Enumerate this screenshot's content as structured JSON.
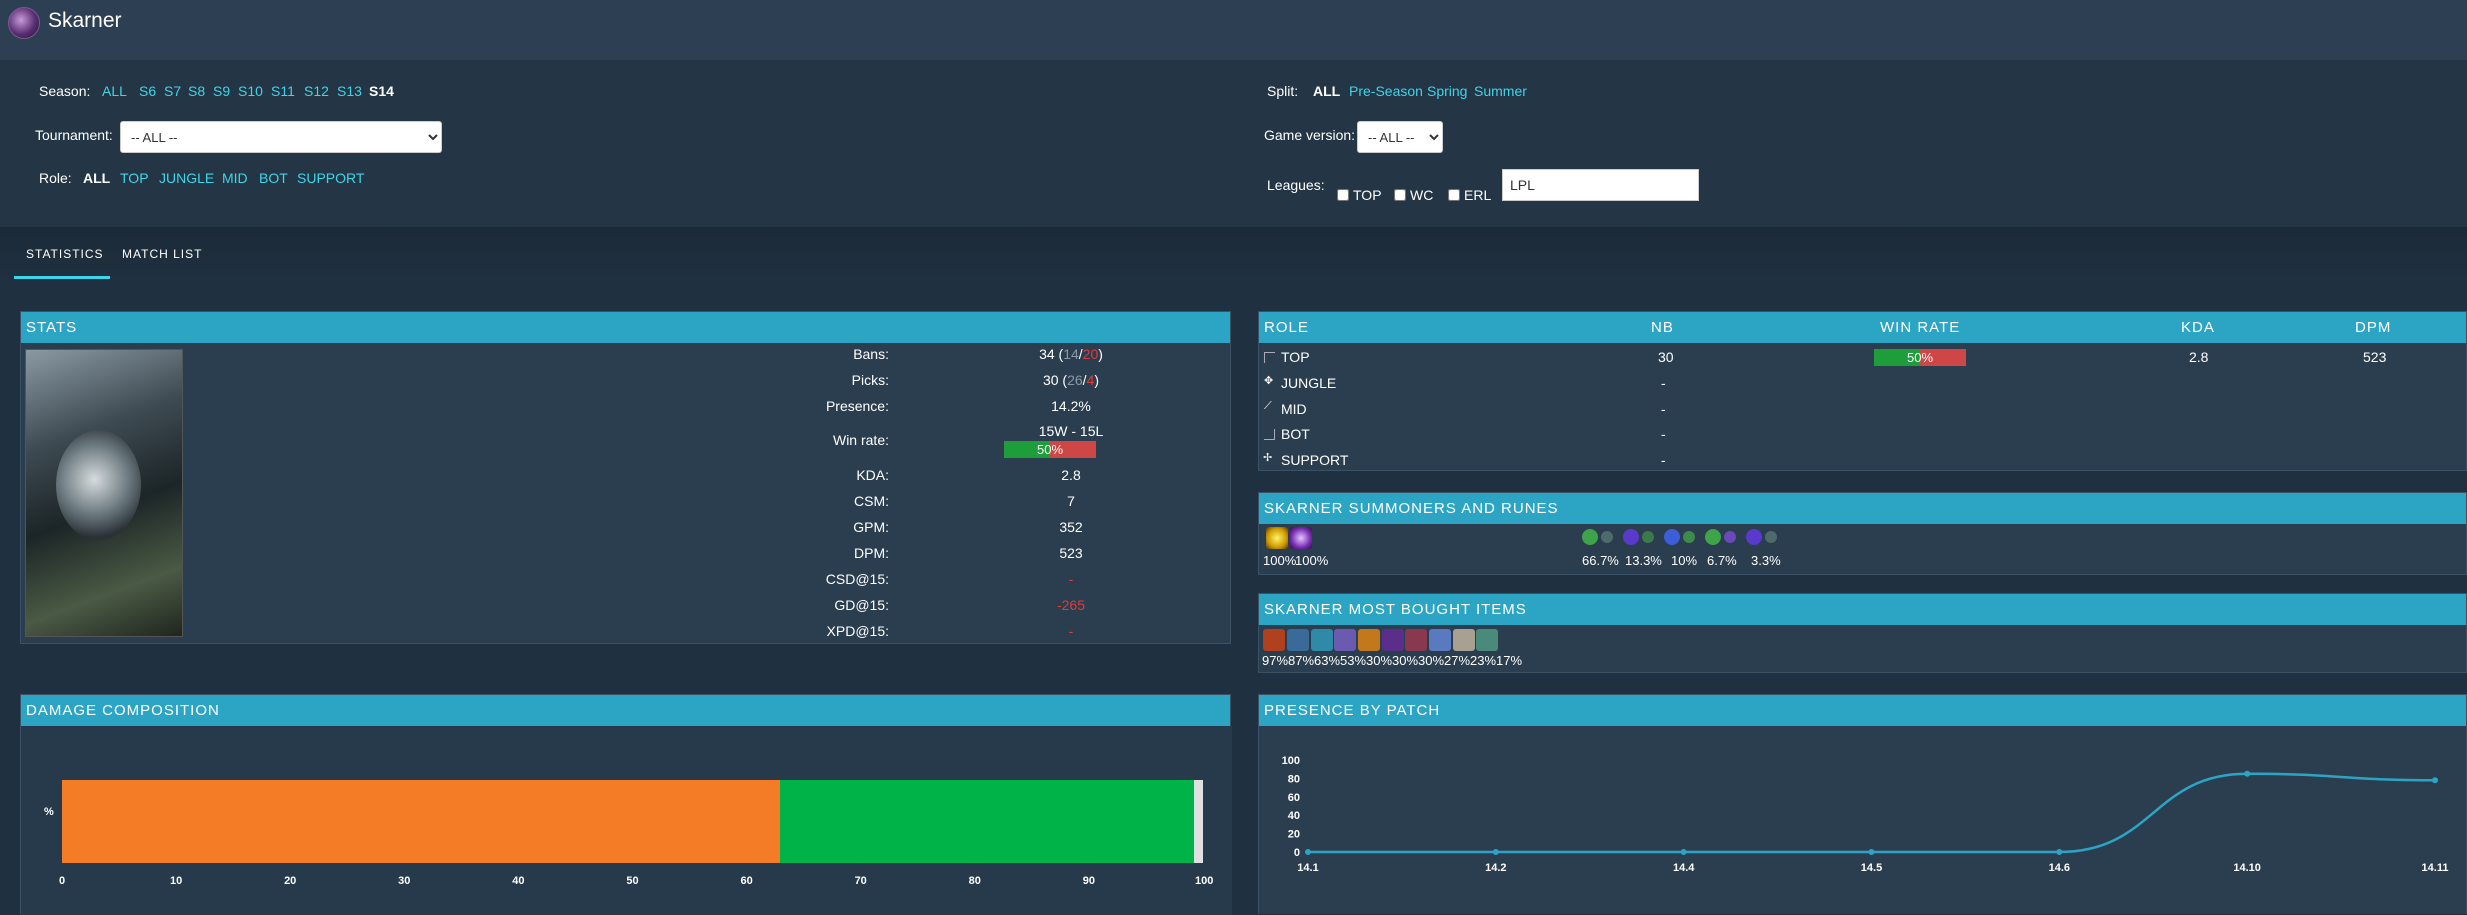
{
  "header": {
    "champion": "Skarner"
  },
  "filters": {
    "season_label": "Season:",
    "seasons": [
      "ALL",
      "S6",
      "S7",
      "S8",
      "S9",
      "S10",
      "S11",
      "S12",
      "S13",
      "S14"
    ],
    "season_active": "S14",
    "tournament_label": "Tournament:",
    "tournament_value": "-- ALL --",
    "role_label": "Role:",
    "roles": [
      "ALL",
      "TOP",
      "JUNGLE",
      "MID",
      "BOT",
      "SUPPORT"
    ],
    "role_active": "ALL",
    "split_label": "Split:",
    "splits": [
      "ALL",
      "Pre-Season",
      "Spring",
      "Summer"
    ],
    "split_active": "ALL",
    "game_version_label": "Game version:",
    "game_version_value": "-- ALL --",
    "leagues_label": "Leagues:",
    "league_checkboxes": [
      "TOP",
      "WC",
      "ERL"
    ],
    "leagues_input": "LPL"
  },
  "tabs": [
    "STATISTICS",
    "MATCH LIST"
  ],
  "stats": {
    "title": "STATS",
    "rows": [
      {
        "label": "Bans:",
        "value": "34 (",
        "a": "14",
        "sep": "/",
        "b": "20",
        "end": ")"
      },
      {
        "label": "Picks:",
        "value": "30 (",
        "a": "26",
        "sep": "/",
        "b": "4",
        "end": ")"
      },
      {
        "label": "Presence:",
        "value": "14.2%"
      },
      {
        "label": "Win rate:",
        "value": "15W - 15L"
      },
      {
        "label": "KDA:",
        "value": "2.8"
      },
      {
        "label": "CSM:",
        "value": "7"
      },
      {
        "label": "GPM:",
        "value": "352"
      },
      {
        "label": "DPM:",
        "value": "523"
      },
      {
        "label": "CSD@15:",
        "value": "-"
      },
      {
        "label": "GD@15:",
        "value": "-265"
      },
      {
        "label": "XPD@15:",
        "value": "-"
      }
    ],
    "win_rate_bar": {
      "value": 0.5,
      "text": "50%"
    }
  },
  "roles_table": {
    "headers": [
      "ROLE",
      "NB",
      "WIN RATE",
      "KDA",
      "DPM"
    ],
    "rows": [
      {
        "role": "TOP",
        "nb": "30",
        "winrate": 0.5,
        "winrate_text": "50%",
        "kda": "2.8",
        "dpm": "523"
      },
      {
        "role": "JUNGLE",
        "nb": "-"
      },
      {
        "role": "MID",
        "nb": "-"
      },
      {
        "role": "BOT",
        "nb": "-"
      },
      {
        "role": "SUPPORT",
        "nb": "-"
      }
    ]
  },
  "summoners": {
    "title": "SKARNER SUMMONERS AND RUNES",
    "spells": [
      "100%",
      "100%"
    ],
    "runes": [
      "66.7%",
      "13.3%",
      "10%",
      "6.7%",
      "3.3%"
    ]
  },
  "items": {
    "title": "SKARNER MOST BOUGHT ITEMS",
    "pcts": [
      "97%",
      "87%",
      "63%",
      "53%",
      "30%",
      "30%",
      "30%",
      "27%",
      "23%",
      "17%"
    ]
  },
  "damage": {
    "title": "DAMAGE COMPOSITION",
    "ylabel": "%",
    "colors": {
      "physical": "#f47c26",
      "magic": "#00b349",
      "true": "#e0e0e0"
    },
    "chart_data": {
      "type": "bar",
      "categories": [
        "%"
      ],
      "series": [
        {
          "values": [
            62.9
          ]
        },
        {
          "values": [
            36.3
          ]
        },
        {
          "values": [
            0.8
          ]
        }
      ],
      "xlim": [
        0,
        100
      ],
      "xticks": [
        "0",
        "10",
        "20",
        "30",
        "40",
        "50",
        "60",
        "70",
        "80",
        "90",
        "100"
      ]
    }
  },
  "presence": {
    "title": "PRESENCE BY PATCH",
    "chart_data": {
      "type": "line",
      "x": [
        "14.1",
        "14.2",
        "14.4",
        "14.5",
        "14.6",
        "14.10",
        "14.11"
      ],
      "values": [
        0,
        0,
        0,
        0,
        0,
        85,
        78
      ],
      "ylim": [
        0,
        100
      ],
      "yticks": [
        "0",
        "20",
        "40",
        "60",
        "80",
        "100"
      ],
      "line_color": "#2ca5c5"
    }
  }
}
